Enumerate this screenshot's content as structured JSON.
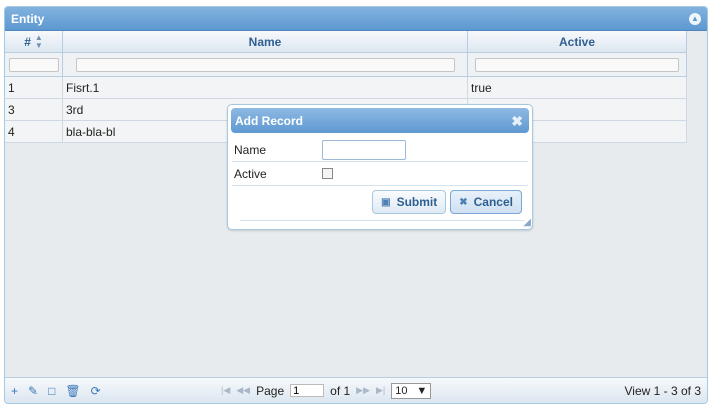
{
  "grid": {
    "title": "Entity",
    "collapse_icon": "collapse-up-icon",
    "columns": [
      "#",
      "Name",
      "Active"
    ],
    "sort_icon": "sort-icon",
    "rows": [
      [
        "1",
        "Fisrt.1",
        "true"
      ],
      [
        "3",
        "3rd",
        ""
      ],
      [
        "4",
        "bla-bla-bl",
        ""
      ]
    ],
    "pager": {
      "left_icons": [
        "add-icon",
        "edit-icon",
        "view-icon",
        "delete-icon",
        "refresh-icon"
      ],
      "page_label": "Page",
      "page_value": "1",
      "of_label": "of 1",
      "page_size": "10",
      "view_text": "View 1 - 3 of 3"
    }
  },
  "dialog": {
    "title": "Add Record",
    "close_icon": "close-icon",
    "fields": {
      "name_label": "Name",
      "name_value": "",
      "active_label": "Active"
    },
    "buttons": {
      "submit_label": "Submit",
      "cancel_label": "Cancel"
    }
  }
}
